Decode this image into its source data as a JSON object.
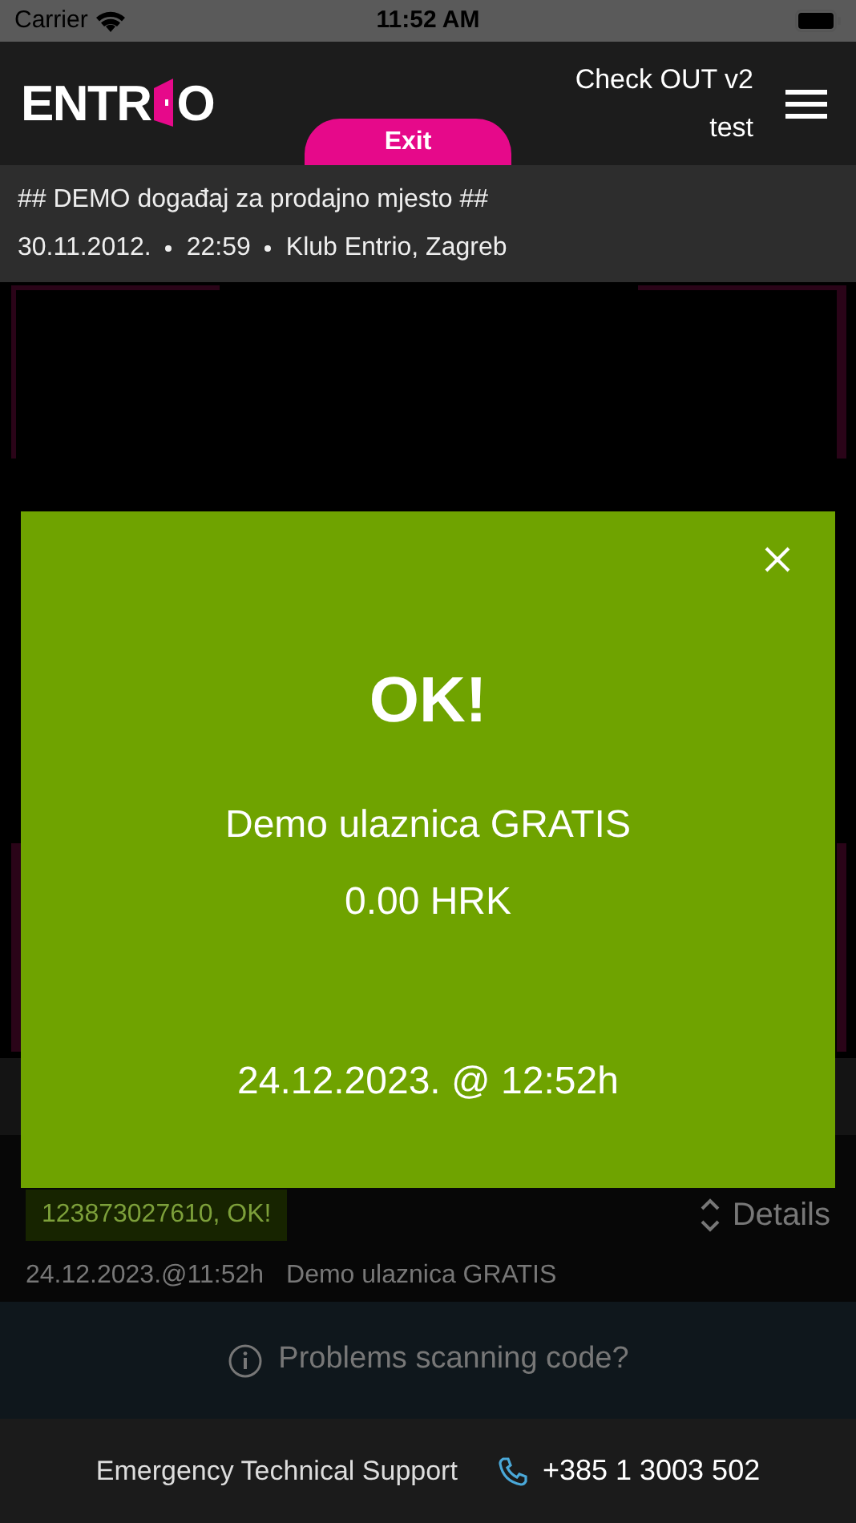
{
  "status_bar": {
    "carrier": "Carrier",
    "time": "11:52 AM"
  },
  "header": {
    "logo_left": "ENTR",
    "logo_right": "O",
    "title": "Check OUT v2",
    "subtitle": "test",
    "exit_button": "Exit"
  },
  "event": {
    "name": "## DEMO događaj za prodajno mjesto ##",
    "date": "30.11.2012.",
    "time": "22:59",
    "venue": "Klub Entrio, Zagreb"
  },
  "last_scan": {
    "code": "123873027610, OK!",
    "details_button": "Details",
    "timestamp": "24.12.2023.@11:52h",
    "ticket": "Demo ulaznica GRATIS"
  },
  "help_banner": {
    "text": "Problems scanning code?"
  },
  "footer": {
    "label": "Emergency Technical Support",
    "phone": "+385 1 3003 502"
  },
  "result_dialog": {
    "success": true,
    "title": "OK!",
    "ticket": "Demo ulaznica GRATIS",
    "price": "0.00 HRK",
    "time": "24.12.2023. @ 12:52h"
  }
}
